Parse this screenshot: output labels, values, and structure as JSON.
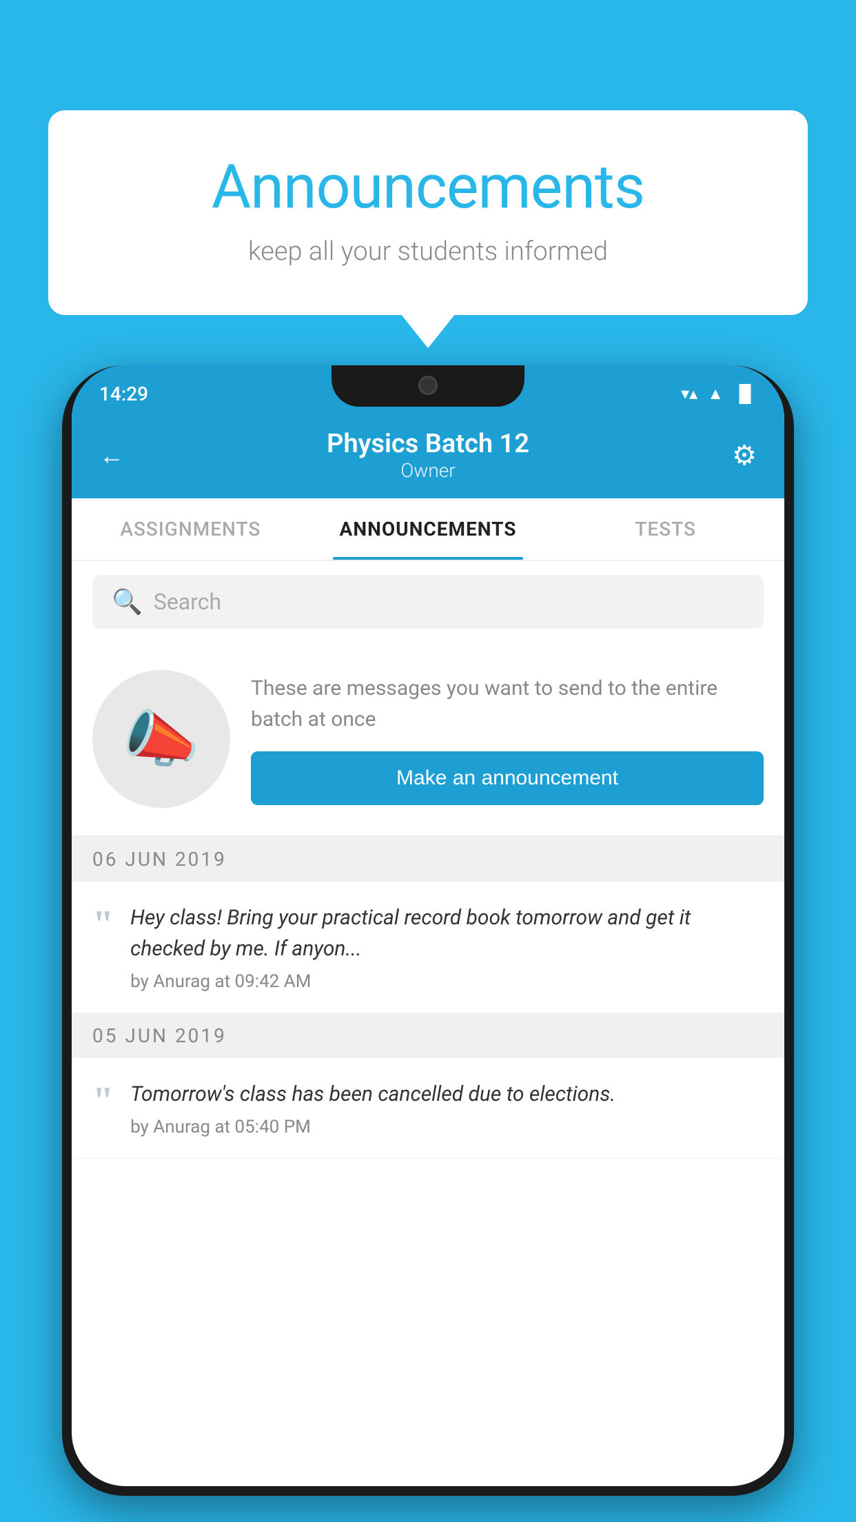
{
  "bubble": {
    "title": "Announcements",
    "subtitle": "keep all your students informed"
  },
  "status_bar": {
    "time": "14:29",
    "wifi": "▼",
    "signal": "▲",
    "battery": "▐"
  },
  "header": {
    "back_label": "←",
    "title": "Physics Batch 12",
    "subtitle": "Owner",
    "gear": "⚙"
  },
  "tabs": [
    {
      "id": "assignments",
      "label": "ASSIGNMENTS",
      "active": false
    },
    {
      "id": "announcements",
      "label": "ANNOUNCEMENTS",
      "active": true
    },
    {
      "id": "tests",
      "label": "TESTS",
      "active": false
    }
  ],
  "search": {
    "placeholder": "Search"
  },
  "cta": {
    "description": "These are messages you want to send to the entire batch at once",
    "button_label": "Make an announcement"
  },
  "announcements": [
    {
      "date": "06  JUN  2019",
      "text": "Hey class! Bring your practical record book tomorrow and get it checked by me. If anyon...",
      "meta": "by Anurag at 09:42 AM"
    },
    {
      "date": "05  JUN  2019",
      "text": "Tomorrow's class has been cancelled due to elections.",
      "meta": "by Anurag at 05:40 PM"
    }
  ],
  "colors": {
    "bg": "#29b6e8",
    "header": "#1e9fd4",
    "btn": "#1e9fd4",
    "tab_active": "#222222",
    "tab_inactive": "#aaaaaa"
  }
}
